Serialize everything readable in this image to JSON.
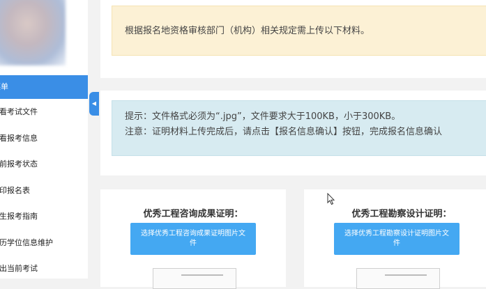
{
  "sidebar": {
    "items": [
      {
        "label": "菜单",
        "active": true
      },
      {
        "label": "查看考试文件"
      },
      {
        "label": "查看报考信息"
      },
      {
        "label": "当前报考状态"
      },
      {
        "label": "打印报名表"
      },
      {
        "label": "考生报考指南"
      },
      {
        "label": "学历学位信息维护"
      },
      {
        "label": "退出当前考试"
      }
    ]
  },
  "notices": {
    "yellow_text": "根据报名地资格审核部门（机构）相关规定需上传以下材料。",
    "blue_line1": "提示：文件格式必须为“.jpg”，文件要求大于100KB，小于300KB。",
    "blue_line2": "注意：证明材料上传完成后，请点击【报名信息确认】按钮，完成报名信息确认"
  },
  "uploads": [
    {
      "title": "优秀工程咨询成果证明：",
      "button_label": "选择优秀工程咨询成果证明图片文件"
    },
    {
      "title": "优秀工程勘察设计证明：",
      "button_label": "选择优秀工程勘察设计证明图片文件"
    }
  ],
  "colors": {
    "accent": "#3a8ee6",
    "button": "#44a8f2",
    "notice_yellow": "#fcf1d5",
    "notice_blue": "#d7ebf1"
  },
  "icons": {
    "collapse": "chevron-left-icon",
    "cursor": "mouse-pointer-icon"
  }
}
